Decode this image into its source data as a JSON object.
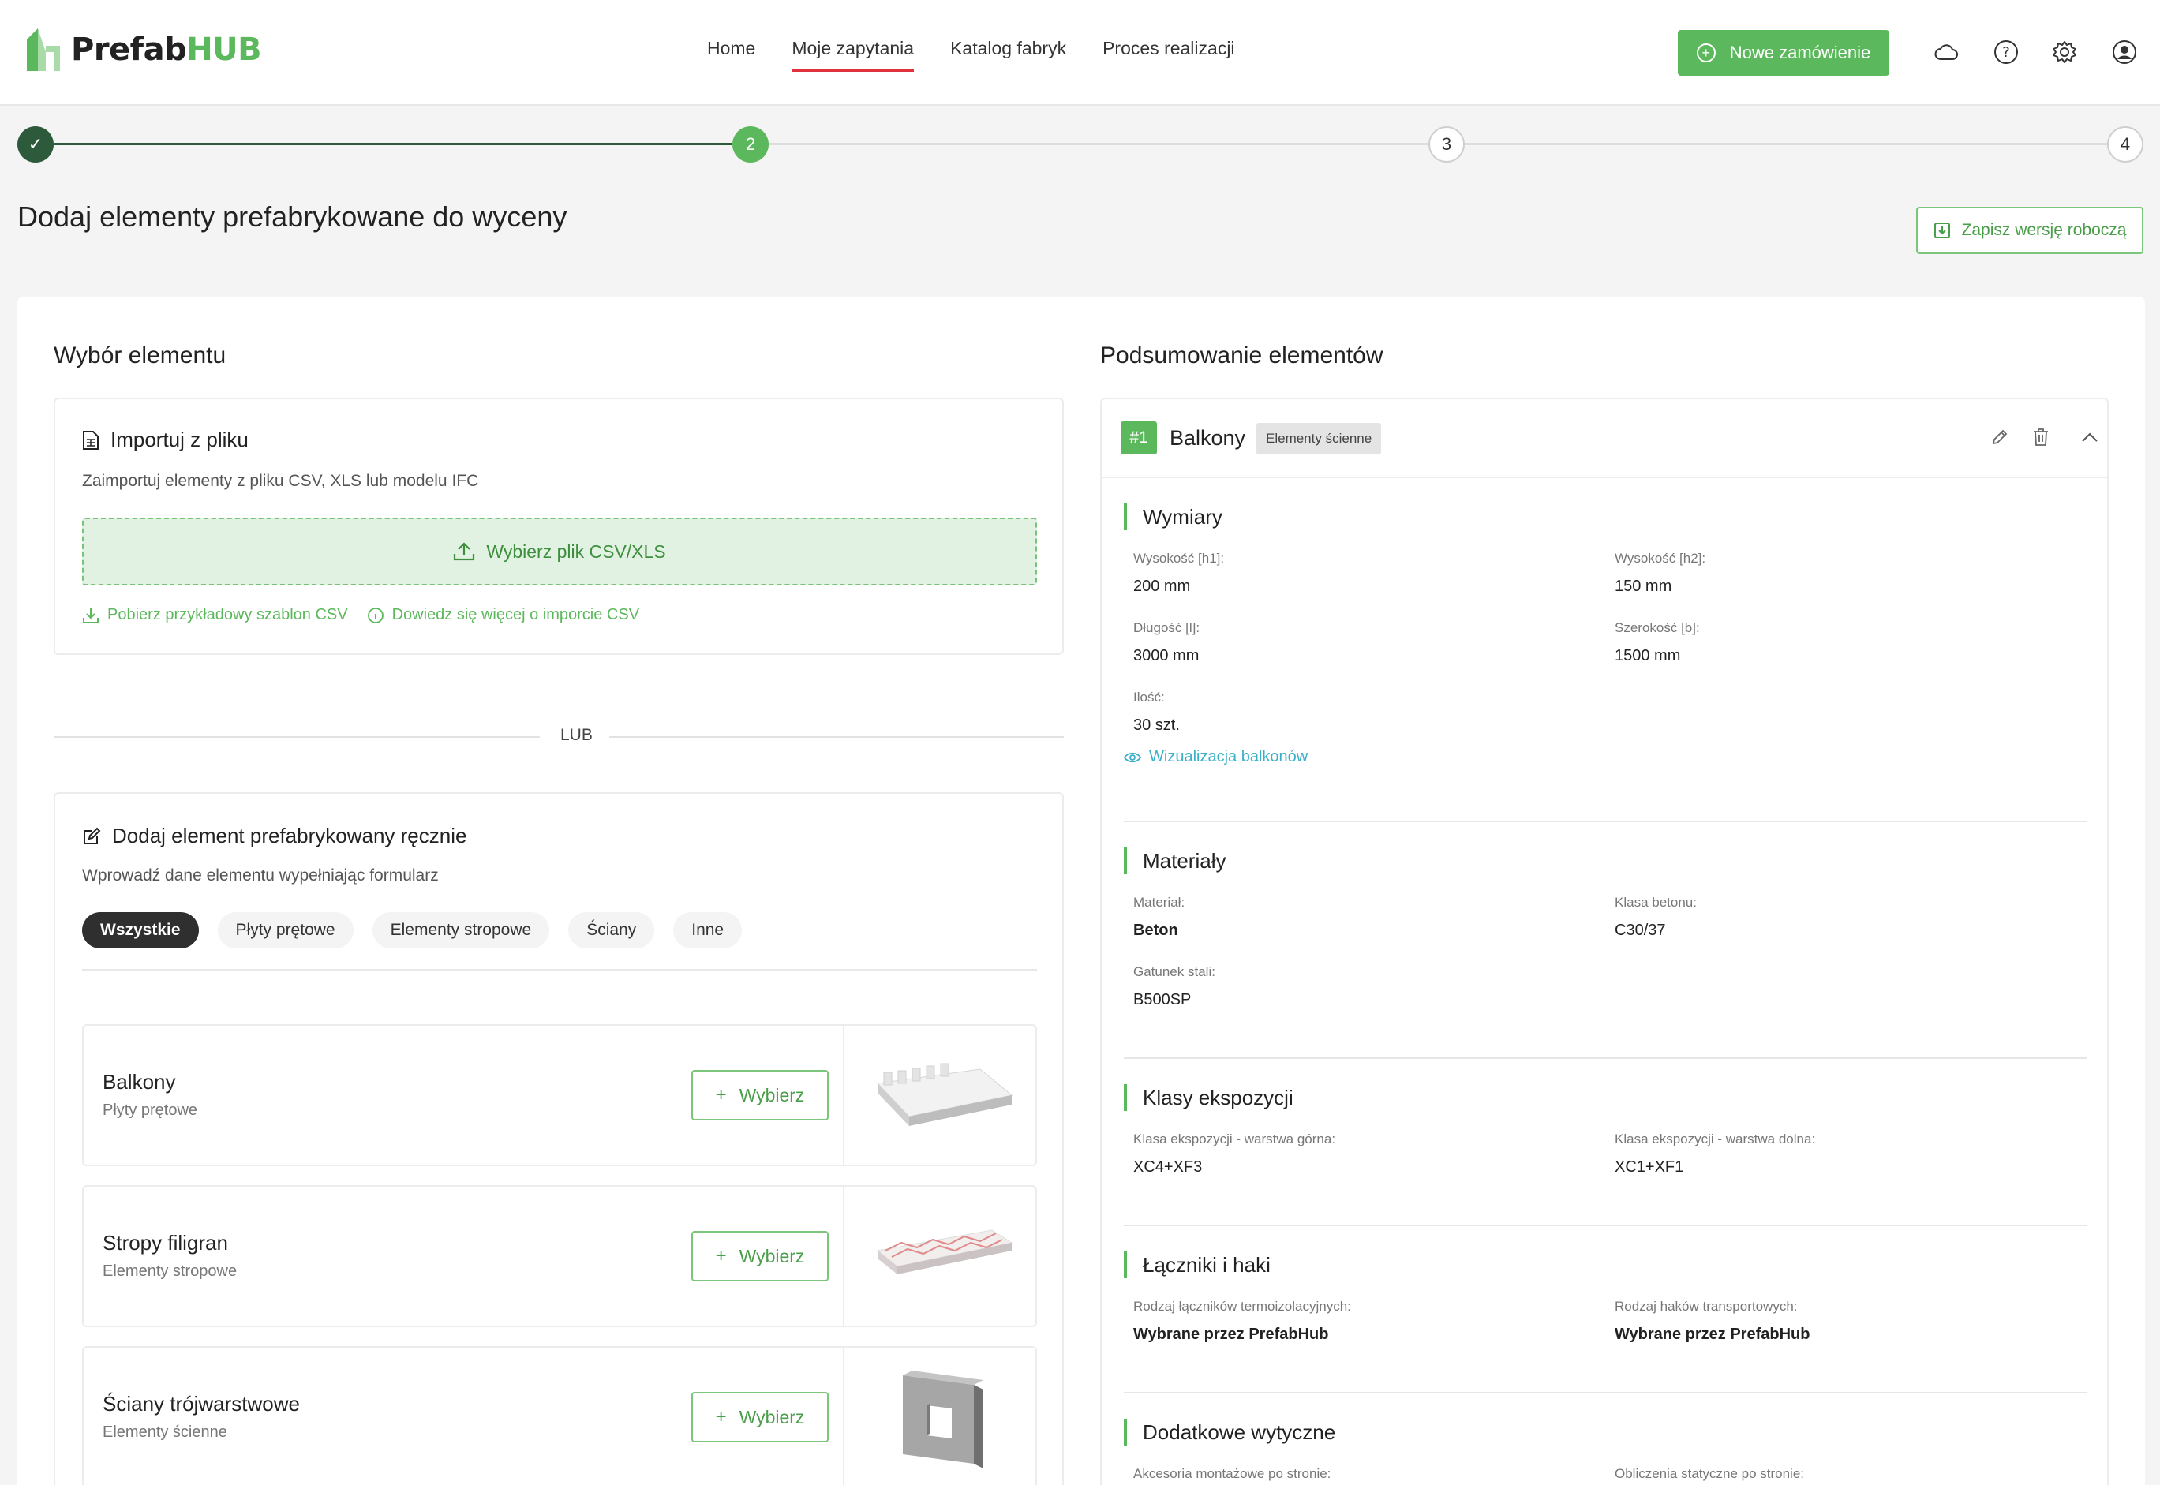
{
  "app": {
    "logo_prefix": "Prefab",
    "logo_suffix": "HUB",
    "nav": [
      {
        "label": "Home"
      },
      {
        "label": "Moje zapytania"
      },
      {
        "label": "Katalog fabryk"
      },
      {
        "label": "Proces realizacji"
      }
    ],
    "new_order_label": "Nowe zamówienie",
    "icons": [
      "cloud-icon",
      "help-icon",
      "gear-icon",
      "user-icon"
    ],
    "accent_color": "#5cb85c",
    "active_nav_underline": "#e0323c"
  },
  "stepper": {
    "steps": [
      {
        "label": "✓",
        "state": "done"
      },
      {
        "label": "2",
        "state": "current"
      },
      {
        "label": "3",
        "state": "todo"
      },
      {
        "label": "4",
        "state": "todo"
      }
    ]
  },
  "page": {
    "title": "Dodaj elementy prefabrykowane do wyceny",
    "save_draft_label": "Zapisz wersję roboczą"
  },
  "left": {
    "title": "Wybór elementu",
    "import": {
      "heading": "Importuj z pliku",
      "desc": "Zaimportuj elementy z pliku CSV, XLS lub modelu IFC",
      "upload_label": "Wybierz plik CSV/XLS",
      "link_template": "Pobierz przykładowy szablon CSV",
      "link_learn": "Dowiedz się więcej o imporcie CSV"
    },
    "or_label": "LUB",
    "manual": {
      "heading": "Dodaj element prefabrykowany ręcznie",
      "desc": "Wprowadź dane elementu wypełniając formularz",
      "chips": [
        {
          "label": "Wszystkie",
          "active": true
        },
        {
          "label": "Płyty prętowe",
          "active": false
        },
        {
          "label": "Elementy stropowe",
          "active": false
        },
        {
          "label": "Ściany",
          "active": false
        },
        {
          "label": "Inne",
          "active": false
        }
      ],
      "select_label": "Wybierz",
      "elements": [
        {
          "name": "Balkony",
          "category": "Płyty prętowe"
        },
        {
          "name": "Stropy filigran",
          "category": "Elementy stropowe"
        },
        {
          "name": "Ściany trójwarstwowe",
          "category": "Elementy ścienne"
        }
      ]
    }
  },
  "summary": {
    "title": "Podsumowanie elementów",
    "item": {
      "number": "#1",
      "name": "Balkony",
      "tag": "Elementy ścienne"
    },
    "groups": {
      "wymiary": {
        "title": "Wymiary",
        "fields": [
          {
            "label": "Wysokość [h1]:",
            "value": "200 mm"
          },
          {
            "label": "Wysokość [h2]:",
            "value": "150 mm"
          },
          {
            "label": "Długość [l]:",
            "value": "3000 mm"
          },
          {
            "label": "Szerokość [b]:",
            "value": "1500 mm"
          },
          {
            "label": "Ilość:",
            "value": "30 szt."
          }
        ],
        "viz_link": "Wizualizacja balkonów"
      },
      "materialy": {
        "title": "Materiały",
        "fields": [
          {
            "label": "Materiał:",
            "value": "Beton"
          },
          {
            "label": "Klasa betonu:",
            "value": "C30/37"
          },
          {
            "label": "Gatunek stali:",
            "value": "B500SP"
          }
        ]
      },
      "ekspozycja": {
        "title": "Klasy ekspozycji",
        "fields": [
          {
            "label": "Klasa ekspozycji - warstwa górna:",
            "value": "XC4+XF3"
          },
          {
            "label": "Klasa ekspozycji - warstwa dolna:",
            "value": "XC1+XF1"
          }
        ]
      },
      "laczniki": {
        "title": "Łączniki i haki",
        "fields": [
          {
            "label": "Rodzaj łączników termoizolacyjnych:",
            "value": "Wybrane przez PrefabHub"
          },
          {
            "label": "Rodzaj haków transportowych:",
            "value": "Wybrane przez PrefabHub"
          }
        ]
      },
      "wytyczne": {
        "title": "Dodatkowe wytyczne",
        "fields": [
          {
            "label": "Akcesoria montażowe po stronie:",
            "value": ""
          },
          {
            "label": "Obliczenia statyczne po stronie:",
            "value": ""
          }
        ]
      }
    }
  }
}
